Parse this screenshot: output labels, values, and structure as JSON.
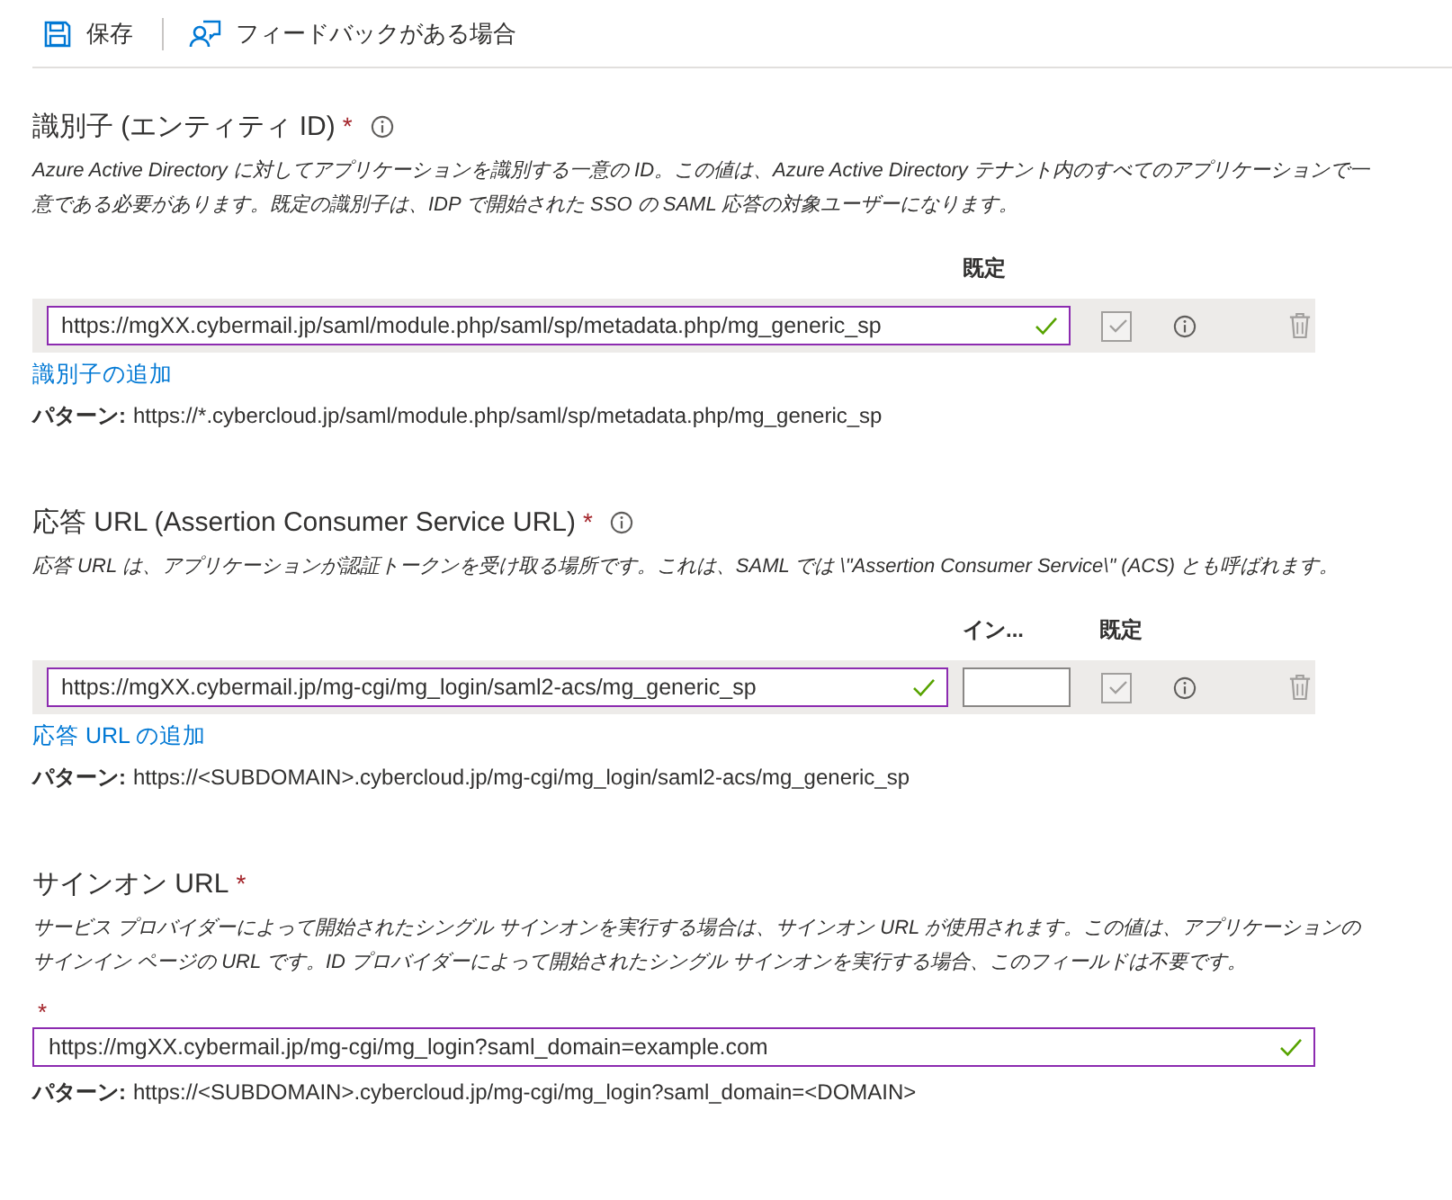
{
  "toolbar": [
    {
      "kind": "save",
      "label": "保存"
    },
    {
      "kind": "feedback",
      "label": "フィードバックがある場合"
    }
  ],
  "sections": [
    {
      "kind": "table",
      "title": "識別子 (エンティティ ID)",
      "required_mark": "*",
      "info": true,
      "description": "Azure Active Directory に対してアプリケーションを識別する一意の ID。この値は、Azure Active Directory テナント内のすべてのアプリケーションで一意である必要があります。既定の識別子は、IDP で開始された SSO の SAML 応答の対象ユーザーになります。",
      "columns": [
        {
          "label": "既定"
        }
      ],
      "rows": [
        {
          "value": "https://mgXX.cybermail.jp/saml/module.php/saml/sp/metadata.php/mg_generic_sp",
          "valid": true,
          "has_index": false,
          "default_checked": true,
          "disabled": true
        }
      ],
      "add_link": "識別子の追加",
      "pattern_label": "パターン:",
      "pattern": "https://*.cybercloud.jp/saml/module.php/saml/sp/metadata.php/mg_generic_sp"
    },
    {
      "kind": "table",
      "title": "応答 URL (Assertion Consumer Service URL)",
      "required_mark": "*",
      "info": true,
      "description": "応答 URL は、アプリケーションが認証トークンを受け取る場所です。これは、SAML では \\\"Assertion Consumer Service\\\" (ACS) とも呼ばれます。",
      "columns": [
        {
          "label": "イン..."
        },
        {
          "label": "既定"
        }
      ],
      "rows": [
        {
          "value": "https://mgXX.cybermail.jp/mg-cgi/mg_login/saml2-acs/mg_generic_sp",
          "valid": true,
          "has_index": true,
          "default_checked": true,
          "disabled": true
        }
      ],
      "add_link": "応答 URL の追加",
      "pattern_label": "パターン:",
      "pattern": "https://<SUBDOMAIN>.cybercloud.jp/mg-cgi/mg_login/saml2-acs/mg_generic_sp"
    },
    {
      "kind": "single",
      "title": "サインオン URL",
      "required_mark": "*",
      "description": "サービス プロバイダーによって開始されたシングル サインオンを実行する場合は、サインオン URL が使用されます。この値は、アプリケーションのサインイン ページの URL です。ID プロバイダーによって開始されたシングル サインオンを実行する場合、このフィールドは不要です。",
      "field_mark": "*",
      "value": "https://mgXX.cybermail.jp/mg-cgi/mg_login?saml_domain=example.com",
      "valid": true,
      "pattern_label": "パターン:",
      "pattern": "https://<SUBDOMAIN>.cybercloud.jp/mg-cgi/mg_login?saml_domain=<DOMAIN>"
    }
  ]
}
